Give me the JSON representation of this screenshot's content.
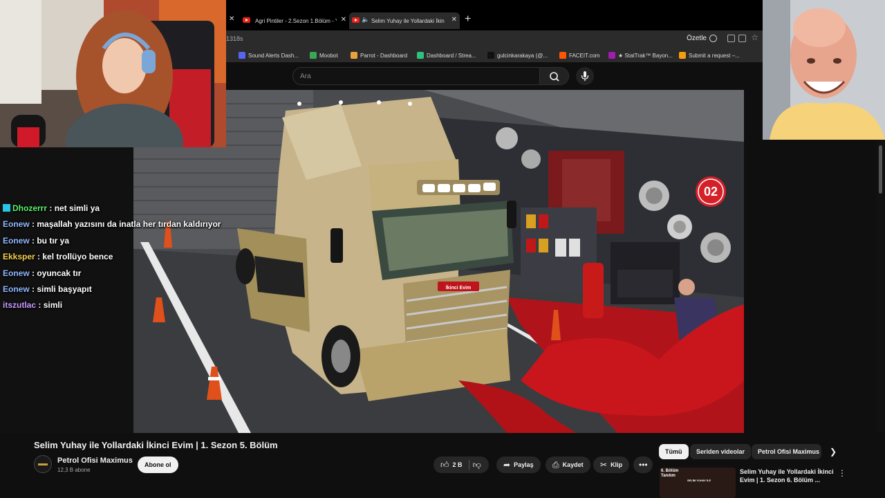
{
  "browser": {
    "tabs": [
      {
        "label": "Agri Pintiler - 2.Sezon 1.Bölüm - Yo"
      },
      {
        "label": "Selim Yuhay ile Yollardaki İkinci"
      }
    ],
    "url_fragment": "1318s",
    "summarize_label": "Özetle",
    "bookmarks": [
      {
        "label": "Sound Alerts Dash...",
        "color": "#5865f2"
      },
      {
        "label": "Moobot",
        "color": "#3aa757"
      },
      {
        "label": "Parrot - Dashboard",
        "color": "#e8a33d"
      },
      {
        "label": "Dashboard / Strea...",
        "color": "#2ec27e"
      },
      {
        "label": "gulcinkarakaya (@...",
        "color": "#111111"
      },
      {
        "label": "FACEIT.com",
        "color": "#ff5500"
      },
      {
        "label": "★ StatTrak™ Bayon...",
        "color": "#a21caf"
      },
      {
        "label": "Submit a request –...",
        "color": "#f59e0b"
      }
    ]
  },
  "youtube": {
    "search_placeholder": "Ara"
  },
  "chat": [
    {
      "user": "Dhozerrr",
      "color": "#5cf26a",
      "msg": "net simli ya",
      "badge": true
    },
    {
      "user": "Eonew",
      "color": "#8fb8ff",
      "msg": "maşallah yazısını da inatla her tırdan kaldırıyor"
    },
    {
      "user": "Eonew",
      "color": "#8fb8ff",
      "msg": "bu tır ya"
    },
    {
      "user": "Ekksper",
      "color": "#f5d04a",
      "msg": "kel trollüyo bence"
    },
    {
      "user": "Eonew",
      "color": "#8fb8ff",
      "msg": "oyuncak tır"
    },
    {
      "user": "Eonew",
      "color": "#8fb8ff",
      "msg": "simli başyapıt"
    },
    {
      "user": "itszutlac",
      "color": "#c79bff",
      "msg": "simli"
    }
  ],
  "video": {
    "title": "Selim Yuhay ile Yollardaki İkinci Evim | 1. Sezon 5. Bölüm",
    "channel": "Petrol Ofisi Maximus",
    "subscribers": "12,3 B abone",
    "subscribe_label": "Abone ol",
    "likes": "2 B",
    "share_label": "Paylaş",
    "save_label": "Kaydet",
    "clip_label": "Klip",
    "truck_plate": "İkinci Evim",
    "sign_number": "02"
  },
  "chips": [
    "Tümü",
    "Seriden videolar",
    "Petrol Ofisi Maximus"
  ],
  "recommendation": {
    "thumb_tag": "6. Bölüm Tanıtım",
    "thumb_brand": "SELİM YUHAY İLE",
    "title": "Selim Yuhay ile Yollardaki İkinci Evim | 1. Sezon 6. Bölüm ..."
  }
}
